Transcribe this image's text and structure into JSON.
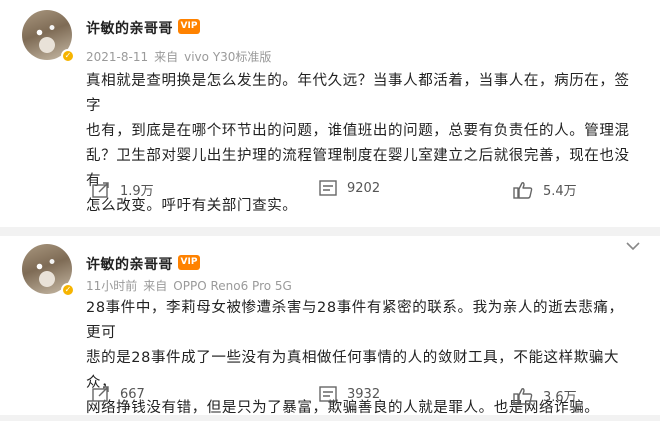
{
  "posts": [
    {
      "author": "许敏的亲哥哥",
      "date": "2021-8-11",
      "source_prefix": "来自",
      "source_device": "vivo Y30标准版",
      "lines": [
        "真相就是查明换是怎么发生的。年代久远？当事人都活着，当事人在，病历在，签字",
        "也有，到底是在哪个环节出的问题，谁值班出的问题，总要有负责任的人。管理混",
        "乱？卫生部对婴儿出生护理的流程管理制度在婴儿室建立之后就很完善，现在也没有",
        "怎么改变。呼吁有关部门查实。"
      ],
      "shares": "1.9万",
      "comments": "9202",
      "likes": "5.4万"
    },
    {
      "author": "许敏的亲哥哥",
      "date": "11小时前",
      "source_prefix": "来自",
      "source_device": "OPPO Reno6 Pro 5G",
      "lines": [
        "28事件中，李莉母女被惨遭杀害与28事件有紧密的联系。我为亲人的逝去悲痛，更可",
        "悲的是28事件成了一些没有为真相做任何事情的人的敛财工具，不能这样欺骗大众，",
        "网络挣钱没有错，但是只为了暴富，欺骗善良的人就是罪人。也是网络诈骗。"
      ],
      "shares": "667",
      "comments": "3932",
      "likes": "3.6万"
    }
  ],
  "icons": {
    "share": "share-icon",
    "comment": "comment-icon",
    "like": "thumbs-up-icon",
    "more": "chevron-down-icon",
    "vip": "vip-badge-icon",
    "verified": "verified-badge-icon"
  },
  "colors": {
    "vip_badge": "#ff8200",
    "verified_badge": "#f6b400",
    "meta_text": "#9a9a9a"
  }
}
